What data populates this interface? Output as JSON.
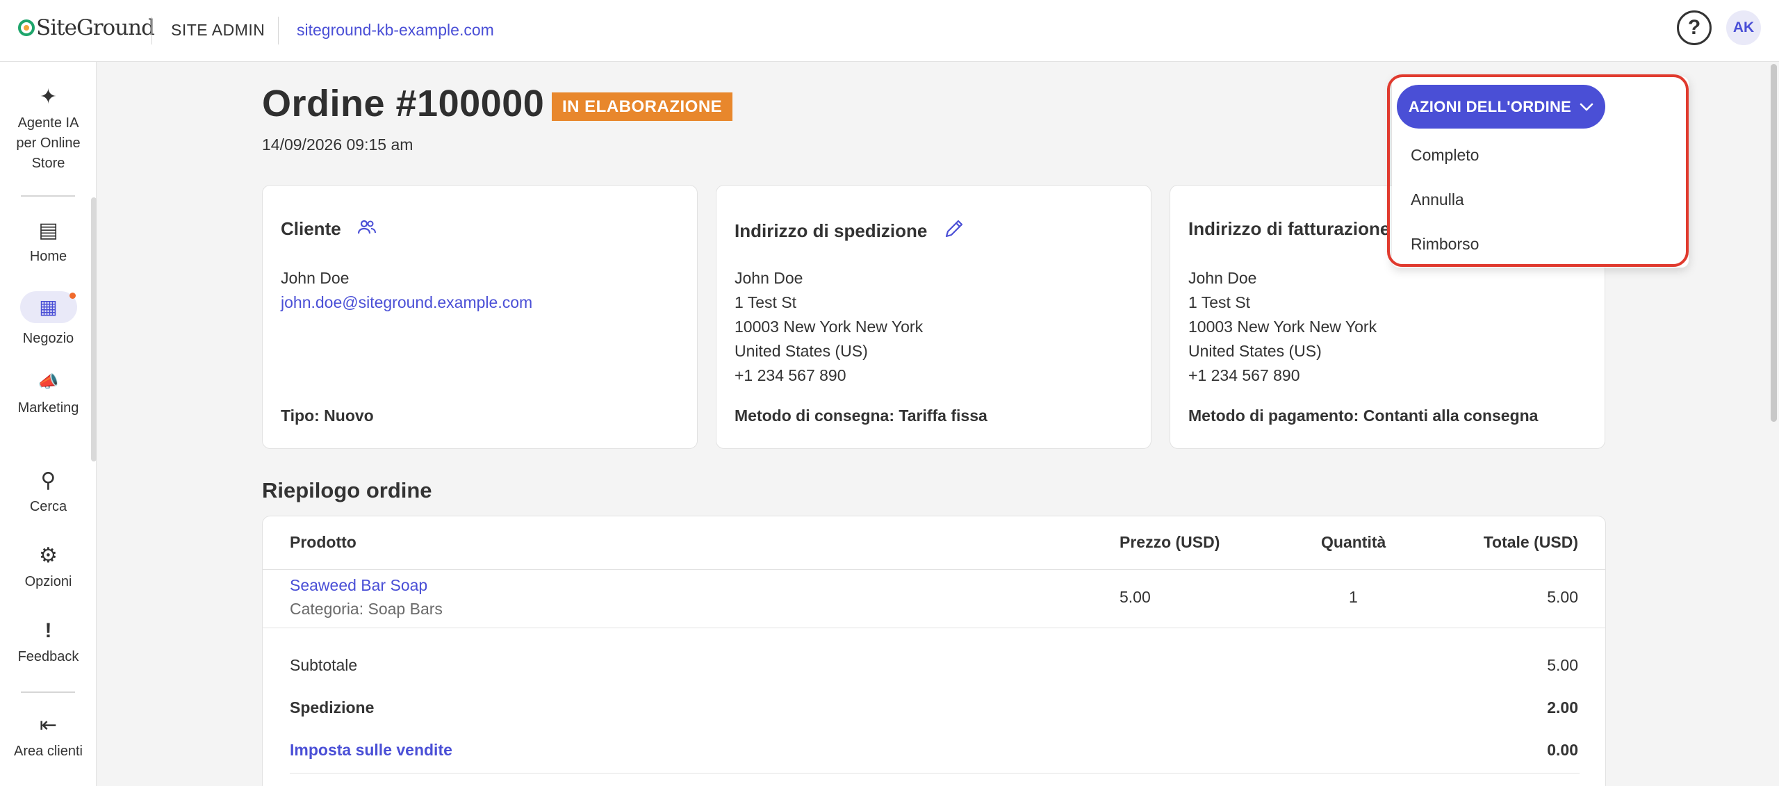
{
  "topbar": {
    "logo_text": "SiteGround",
    "section": "SITE ADMIN",
    "domain": "siteground-kb-example.com",
    "help_icon": "?",
    "avatar_initials": "AK"
  },
  "sidebar": {
    "items": [
      {
        "label": "Agente IA per Online Store",
        "icon": "sparkle-icon",
        "glyph": "✦"
      },
      {
        "label": "Home",
        "icon": "home-icon",
        "glyph": "▤"
      },
      {
        "label": "Negozio",
        "icon": "store-icon",
        "glyph": "▦"
      },
      {
        "label": "Marketing",
        "icon": "megaphone-icon",
        "glyph": "📣"
      },
      {
        "label": "Cerca",
        "icon": "search-icon",
        "glyph": "⚲"
      },
      {
        "label": "Opzioni",
        "icon": "gear-icon",
        "glyph": "⚙"
      },
      {
        "label": "Feedback",
        "icon": "feedback-icon",
        "glyph": "!"
      },
      {
        "label": "Area clienti",
        "icon": "exit-icon",
        "glyph": "⇤"
      }
    ],
    "ai_line1": "Agente IA",
    "ai_line2": "per Online",
    "ai_line3": "Store"
  },
  "order": {
    "title": "Ordine #100000",
    "status": "IN ELABORAZIONE",
    "date": "14/09/2026 09:15 am"
  },
  "actions": {
    "button_label": "AZIONI DELL'ORDINE",
    "menu": [
      "Completo",
      "Annulla",
      "Rimborso"
    ]
  },
  "cards": {
    "customer": {
      "title": "Cliente",
      "name": "John Doe",
      "email": "john.doe@siteground.example.com",
      "footer": "Tipo: Nuovo"
    },
    "shipping": {
      "title": "Indirizzo di spedizione",
      "lines": [
        "John Doe",
        "1 Test St",
        "10003 New York New York",
        "United States (US)",
        "+1 234 567 890"
      ],
      "footer": "Metodo di consegna: Tariffa fissa"
    },
    "billing": {
      "title": "Indirizzo di fatturazione",
      "lines": [
        "John Doe",
        "1 Test St",
        "10003 New York New York",
        "United States (US)",
        "+1 234 567 890"
      ],
      "footer": "Metodo di pagamento: Contanti alla consegna"
    }
  },
  "summary": {
    "title": "Riepilogo ordine",
    "columns": [
      "Prodotto",
      "Prezzo (USD)",
      "Quantità",
      "Totale (USD)"
    ],
    "rows": [
      {
        "product": "Seaweed Bar Soap",
        "category": "Categoria: Soap Bars",
        "price": "5.00",
        "qty": "1",
        "total": "5.00"
      }
    ],
    "subtotal_label": "Subtotale",
    "subtotal": "5.00",
    "shipping_label": "Spedizione",
    "shipping": "2.00",
    "tax_label": "Imposta sulle vendite",
    "tax": "0.00"
  },
  "colors": {
    "accent": "#4a4fd6",
    "status": "#e8872c",
    "highlight": "#e03a2e"
  }
}
